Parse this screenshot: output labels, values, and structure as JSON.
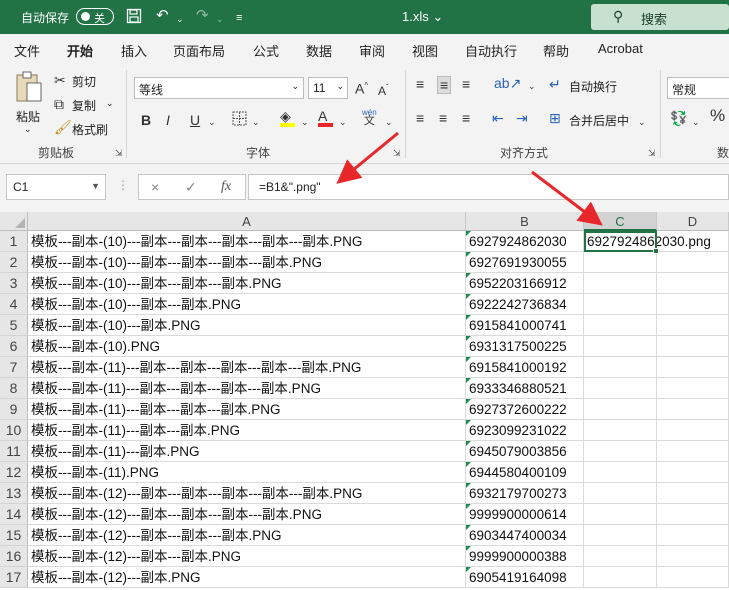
{
  "titlebar": {
    "autosave_label": "自动保存",
    "toggle_state": "关",
    "filename": "1.xls",
    "search_label": "搜索"
  },
  "tabs": [
    "文件",
    "开始",
    "插入",
    "页面布局",
    "公式",
    "数据",
    "审阅",
    "视图",
    "自动执行",
    "帮助",
    "Acrobat"
  ],
  "active_tab": "开始",
  "ribbon": {
    "clipboard": {
      "paste": "粘贴",
      "cut": "剪切",
      "copy": "复制",
      "format_painter": "格式刷",
      "label": "剪贴板"
    },
    "font": {
      "name": "等线",
      "size": "11",
      "bold": "B",
      "italic": "I",
      "underline": "U",
      "label": "字体",
      "wen": "wén",
      "wen2": "文"
    },
    "alignment": {
      "wrap": "自动换行",
      "merge": "合并后居中",
      "label": "对齐方式"
    },
    "number": {
      "format": "常规",
      "percent": "%",
      "label": "数"
    }
  },
  "formula_bar": {
    "name_box": "C1",
    "cancel_icon": "×",
    "enter_icon": "✓",
    "fx": "fx",
    "formula": "=B1&\".png\""
  },
  "sheet": {
    "columns": [
      "A",
      "B",
      "C",
      "D"
    ],
    "rows": [
      {
        "n": "1",
        "a": "模板---副本-(10)---副本---副本---副本---副本---副本.PNG",
        "b": "6927924862030",
        "c": "6927924862030.png"
      },
      {
        "n": "2",
        "a": "模板---副本-(10)---副本---副本---副本---副本.PNG",
        "b": "6927691930055",
        "c": ""
      },
      {
        "n": "3",
        "a": "模板---副本-(10)---副本---副本---副本.PNG",
        "b": "6952203166912",
        "c": ""
      },
      {
        "n": "4",
        "a": "模板---副本-(10)---副本---副本.PNG",
        "b": "6922242736834",
        "c": ""
      },
      {
        "n": "5",
        "a": "模板---副本-(10)---副本.PNG",
        "b": "6915841000741",
        "c": ""
      },
      {
        "n": "6",
        "a": "模板---副本-(10).PNG",
        "b": "6931317500225",
        "c": ""
      },
      {
        "n": "7",
        "a": "模板---副本-(11)---副本---副本---副本---副本---副本.PNG",
        "b": "6915841000192",
        "c": ""
      },
      {
        "n": "8",
        "a": "模板---副本-(11)---副本---副本---副本---副本.PNG",
        "b": "6933346880521",
        "c": ""
      },
      {
        "n": "9",
        "a": "模板---副本-(11)---副本---副本---副本.PNG",
        "b": "6927372600222",
        "c": ""
      },
      {
        "n": "10",
        "a": "模板---副本-(11)---副本---副本.PNG",
        "b": "6923099231022",
        "c": ""
      },
      {
        "n": "11",
        "a": "模板---副本-(11)---副本.PNG",
        "b": "6945079003856",
        "c": ""
      },
      {
        "n": "12",
        "a": "模板---副本-(11).PNG",
        "b": "6944580400109",
        "c": ""
      },
      {
        "n": "13",
        "a": "模板---副本-(12)---副本---副本---副本---副本---副本.PNG",
        "b": "6932179700273",
        "c": ""
      },
      {
        "n": "14",
        "a": "模板---副本-(12)---副本---副本---副本---副本.PNG",
        "b": "9999900000614",
        "c": ""
      },
      {
        "n": "15",
        "a": "模板---副本-(12)---副本---副本---副本.PNG",
        "b": "6903447400034",
        "c": ""
      },
      {
        "n": "16",
        "a": "模板---副本-(12)---副本---副本.PNG",
        "b": "9999900000388",
        "c": ""
      },
      {
        "n": "17",
        "a": "模板---副本-(12)---副本.PNG",
        "b": "6905419164098",
        "c": ""
      }
    ]
  },
  "colors": {
    "brand": "#217346",
    "annotation_arrow": "#e8272a"
  }
}
